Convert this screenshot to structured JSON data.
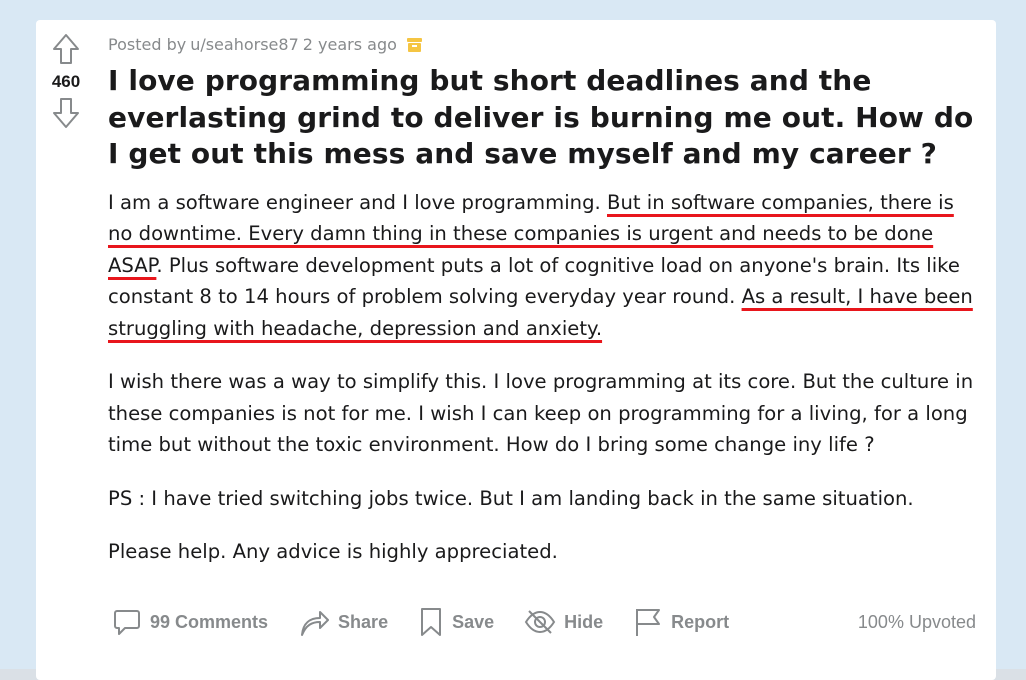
{
  "post": {
    "author_prefix": "Posted by",
    "author": "u/seahorse87",
    "age": "2 years ago",
    "score": "460",
    "title": "I love programming but short deadlines and the everlasting grind to deliver is burning me out. How do I get out this mess and save myself and my career ?",
    "paragraphs": {
      "p1_a": "I am a software engineer and I love programming. ",
      "p1_hl1": "But in software companies, there is no downtime. Every damn thing in these companies is urgent and needs to be done ASAP",
      "p1_b": ". Plus software development puts a lot of cognitive load on anyone's brain. Its like constant 8 to 14 hours of problem solving everyday year round. ",
      "p1_hl2": "As a result, I have been struggling with headache, depression and anxiety.",
      "p2": "I wish there was a way to simplify this. I love programming at its core. But the culture in these companies is not for me. I wish I can keep on programming for a living, for a long time but without the toxic environment. How do I bring some change iny life ?",
      "p3": "PS : I have tried switching jobs twice. But I am landing back in the same situation.",
      "p4": "Please help. Any advice is highly appreciated."
    }
  },
  "actions": {
    "comments": "99 Comments",
    "share": "Share",
    "save": "Save",
    "hide": "Hide",
    "report": "Report",
    "upvoted": "100% Upvoted"
  },
  "colors": {
    "highlight_underline": "#e8161c",
    "meta_gray": "#878a8c",
    "award_gold": "#f5c543"
  },
  "icons": [
    "upvote-arrow-icon",
    "downvote-arrow-icon",
    "award-icon",
    "comment-icon",
    "share-icon",
    "save-icon",
    "hide-icon",
    "report-icon"
  ]
}
